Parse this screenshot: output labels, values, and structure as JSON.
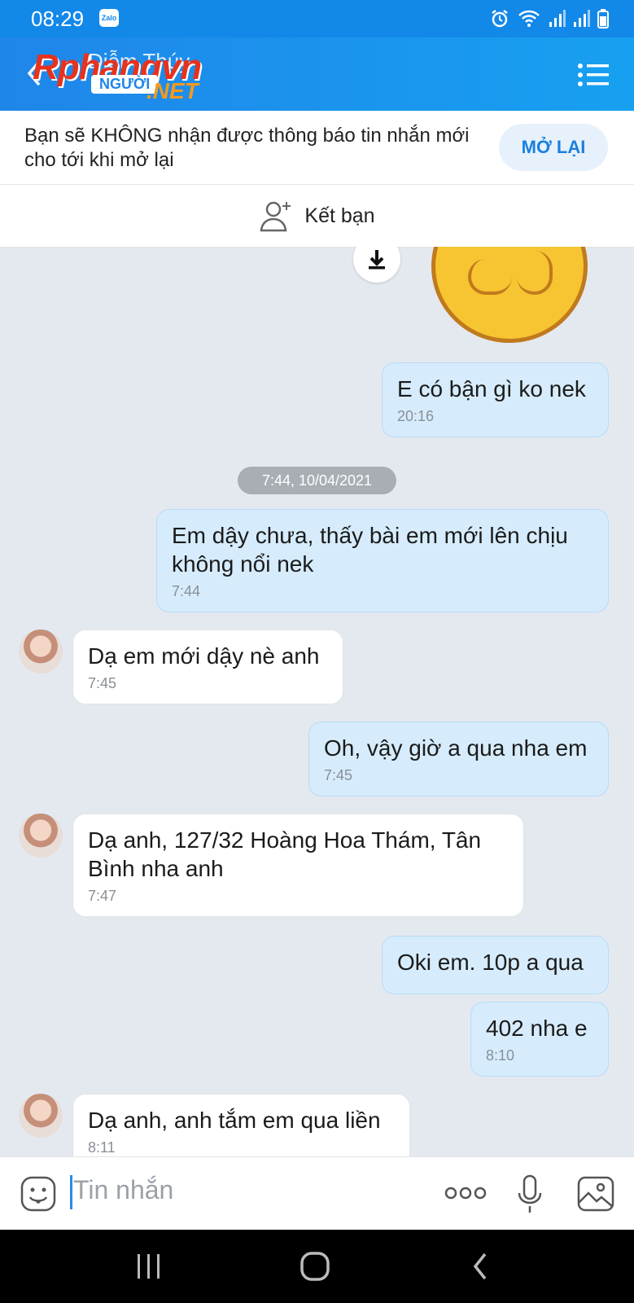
{
  "status_bar": {
    "time": "08:29",
    "app_badge": "Zalo"
  },
  "header": {
    "contact_name": "Diễm Thúy"
  },
  "watermark": {
    "brand": "Rphangvn",
    "sub": "NGƯỜI",
    "domain": ".NET"
  },
  "notice": {
    "text": "Bạn sẽ KHÔNG nhận được thông báo tin nhắn mới cho tới khi mở lại",
    "reopen_label": "MỞ LẠI"
  },
  "add_friend": {
    "label": "Kết bạn"
  },
  "chat": {
    "date_separator": "7:44, 10/04/2021",
    "messages": [
      {
        "from": "me",
        "text": "E có bận gì ko nek",
        "time": "20:16"
      },
      {
        "from": "me",
        "text": "Em dậy chưa, thấy bài em mới lên chịu không nổi nek",
        "time": "7:44"
      },
      {
        "from": "them",
        "text": "Dạ em mới dậy nè anh",
        "time": "7:45"
      },
      {
        "from": "me",
        "text": "Oh, vậy giờ a qua nha em",
        "time": "7:45"
      },
      {
        "from": "them",
        "text": "Dạ anh, 127/32 Hoàng Hoa Thám, Tân Bình nha anh",
        "time": "7:47"
      },
      {
        "from": "me",
        "text": "Oki em. 10p a qua",
        "time": ""
      },
      {
        "from": "me",
        "text": "402 nha e",
        "time": "8:10"
      },
      {
        "from": "them",
        "text": "Dạ anh, anh tắm em qua liền",
        "time": "8:11"
      }
    ]
  },
  "input": {
    "placeholder": "Tin nhắn"
  },
  "colors": {
    "header": "#1f86e9",
    "my_bubble": "#d6ecfc",
    "accent": "#1a7fe0"
  },
  "icons": [
    "back-arrow-icon",
    "menu-list-icon",
    "add-person-icon",
    "download-icon",
    "emoji-icon",
    "more-icon",
    "mic-icon",
    "image-icon",
    "recent-apps-icon",
    "home-icon",
    "nav-back-icon"
  ]
}
